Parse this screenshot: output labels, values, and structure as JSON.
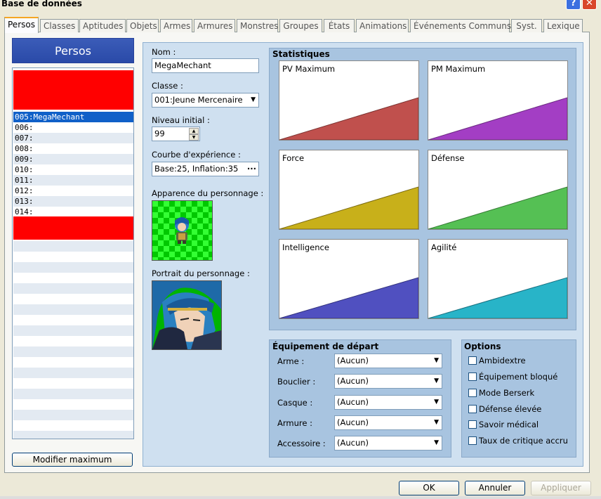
{
  "window": {
    "title": "Base de données",
    "help": "?",
    "close": "✕"
  },
  "tabs": [
    "Persos",
    "Classes",
    "Aptitudes",
    "Objets",
    "Armes",
    "Armures",
    "Monstres",
    "Groupes",
    "États",
    "Animations",
    "Événements Communs",
    "Syst.",
    "Lexique"
  ],
  "sidebar": {
    "header": "Persos",
    "items": [
      "005:MegaMechant",
      "006:",
      "007:",
      "008:",
      "009:",
      "010:",
      "011:",
      "012:",
      "013:",
      "014:"
    ],
    "selected_index": 0,
    "modify_max_label": "Modifier maximum"
  },
  "actor": {
    "name_label": "Nom :",
    "name_value": "MegaMechant",
    "class_label": "Classe :",
    "class_value": "001:Jeune Mercenaire",
    "level_label": "Niveau initial :",
    "level_value": "99",
    "exp_label": "Courbe d'expérience :",
    "exp_value": "Base:25, Inflation:35",
    "appearance_label": "Apparence du personnage :",
    "portrait_label": "Portrait du personnage :"
  },
  "stats": {
    "title": "Statistiques",
    "cards": [
      {
        "label": "PV Maximum",
        "color": "#c0504d"
      },
      {
        "label": "PM Maximum",
        "color": "#a33ec4"
      },
      {
        "label": "Force",
        "color": "#c8b01a"
      },
      {
        "label": "Défense",
        "color": "#55c054"
      },
      {
        "label": "Intelligence",
        "color": "#5050c0"
      },
      {
        "label": "Agilité",
        "color": "#28b4c8"
      }
    ]
  },
  "equipment": {
    "title": "Équipement de départ",
    "rows": [
      {
        "label": "Arme :",
        "value": "(Aucun)"
      },
      {
        "label": "Bouclier :",
        "value": "(Aucun)"
      },
      {
        "label": "Casque :",
        "value": "(Aucun)"
      },
      {
        "label": "Armure :",
        "value": "(Aucun)"
      },
      {
        "label": "Accessoire :",
        "value": "(Aucun)"
      }
    ]
  },
  "options": {
    "title": "Options",
    "items": [
      "Ambidextre",
      "Équipement bloqué",
      "Mode Berserk",
      "Défense élevée",
      "Savoir médical",
      "Taux de critique accru"
    ]
  },
  "buttons": {
    "ok": "OK",
    "cancel": "Annuler",
    "apply": "Appliquer"
  }
}
